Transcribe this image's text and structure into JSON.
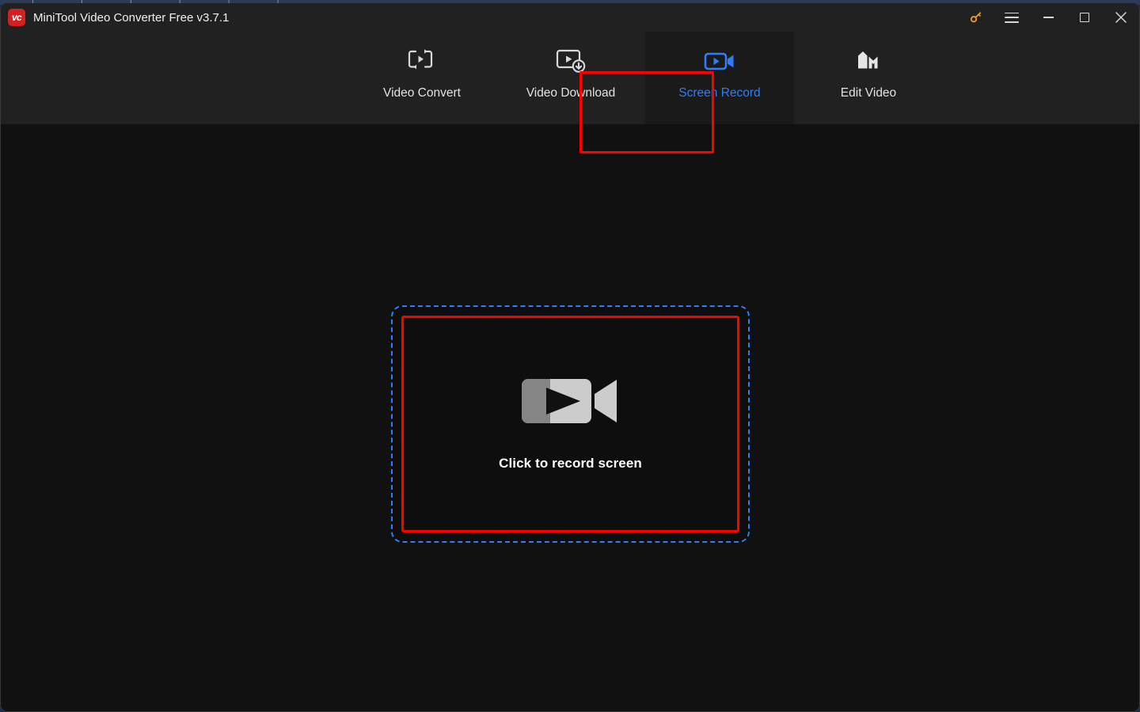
{
  "window": {
    "title": "MiniTool Video Converter Free v3.7.1",
    "logo_text": "vc",
    "logo_color": "#d32020",
    "background_color": "#111111",
    "titlebar_color": "#212121"
  },
  "titlebar_actions": [
    {
      "name": "activate-key",
      "icon": "key-icon",
      "color": "#f0a020"
    },
    {
      "name": "menu",
      "icon": "hamburger-icon"
    },
    {
      "name": "minimize",
      "icon": "minimize-icon"
    },
    {
      "name": "maximize",
      "icon": "maximize-icon"
    },
    {
      "name": "close",
      "icon": "close-icon"
    }
  ],
  "nav": {
    "active_color": "#2d7ff9",
    "tabs": [
      {
        "label": "Video Convert",
        "icon": "video-convert-icon",
        "active": false
      },
      {
        "label": "Video Download",
        "icon": "video-download-icon",
        "active": false
      },
      {
        "label": "Screen Record",
        "icon": "screen-record-icon",
        "active": true
      },
      {
        "label": "Edit Video",
        "icon": "edit-video-icon",
        "active": false
      }
    ]
  },
  "stage": {
    "dropzone": {
      "label": "Click to record screen",
      "icon": "camcorder-icon",
      "border_style": "dashed",
      "border_color": "#2d7ff9"
    }
  },
  "annotations": {
    "color": "#ff0000",
    "boxes": [
      {
        "name": "screen-record-tab-highlight"
      },
      {
        "name": "record-dropzone-highlight"
      }
    ]
  },
  "background": {
    "ghost_strip_text": "| | | | | |"
  }
}
